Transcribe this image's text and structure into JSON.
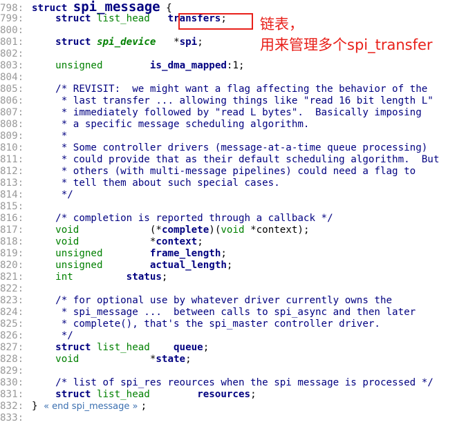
{
  "source": {
    "lines": [
      {
        "num": "798:",
        "segments": [
          {
            "c": "kw",
            "t": "struct "
          },
          {
            "c": "big",
            "t": "spi_message"
          },
          {
            "c": "br",
            "t": " {"
          }
        ]
      },
      {
        "num": "799:",
        "segments": [
          {
            "c": "nm",
            "t": "    "
          },
          {
            "c": "kw",
            "t": "struct "
          },
          {
            "c": "ty",
            "t": "list_head"
          },
          {
            "c": "nm",
            "t": "   "
          },
          {
            "c": "b",
            "t": "transfers"
          },
          {
            "c": "nm",
            "t": ";"
          }
        ]
      },
      {
        "num": "800:",
        "segments": []
      },
      {
        "num": "801:",
        "segments": [
          {
            "c": "nm",
            "t": "    "
          },
          {
            "c": "kw",
            "t": "struct "
          },
          {
            "c": "tyi",
            "t": "spi_device"
          },
          {
            "c": "nm",
            "t": "   *"
          },
          {
            "c": "b",
            "t": "spi"
          },
          {
            "c": "nm",
            "t": ";"
          }
        ]
      },
      {
        "num": "802:",
        "segments": []
      },
      {
        "num": "803:",
        "segments": [
          {
            "c": "nm",
            "t": "    "
          },
          {
            "c": "ty",
            "t": "unsigned"
          },
          {
            "c": "nm",
            "t": "        "
          },
          {
            "c": "b",
            "t": "is_dma_mapped"
          },
          {
            "c": "nm",
            "t": ":1;"
          }
        ]
      },
      {
        "num": "804:",
        "segments": []
      },
      {
        "num": "805:",
        "segments": [
          {
            "c": "cm",
            "t": "    /* REVISIT:  we might want a flag affecting the behavior of the"
          }
        ]
      },
      {
        "num": "806:",
        "segments": [
          {
            "c": "cm",
            "t": "     * last transfer ... allowing things like \"read 16 bit length L\""
          }
        ]
      },
      {
        "num": "807:",
        "segments": [
          {
            "c": "cm",
            "t": "     * immediately followed by \"read L bytes\".  Basically imposing"
          }
        ]
      },
      {
        "num": "808:",
        "segments": [
          {
            "c": "cm",
            "t": "     * a specific message scheduling algorithm."
          }
        ]
      },
      {
        "num": "809:",
        "segments": [
          {
            "c": "cm",
            "t": "     *"
          }
        ]
      },
      {
        "num": "810:",
        "segments": [
          {
            "c": "cm",
            "t": "     * Some controller drivers (message-at-a-time queue processing)"
          }
        ]
      },
      {
        "num": "811:",
        "segments": [
          {
            "c": "cm",
            "t": "     * could provide that as their default scheduling algorithm.  But"
          }
        ]
      },
      {
        "num": "812:",
        "segments": [
          {
            "c": "cm",
            "t": "     * others (with multi-message pipelines) could need a flag to"
          }
        ]
      },
      {
        "num": "813:",
        "segments": [
          {
            "c": "cm",
            "t": "     * tell them about such special cases."
          }
        ]
      },
      {
        "num": "814:",
        "segments": [
          {
            "c": "cm",
            "t": "     */"
          }
        ]
      },
      {
        "num": "815:",
        "segments": []
      },
      {
        "num": "816:",
        "segments": [
          {
            "c": "cm",
            "t": "    /* completion is reported through a callback */"
          }
        ]
      },
      {
        "num": "817:",
        "segments": [
          {
            "c": "nm",
            "t": "    "
          },
          {
            "c": "ty",
            "t": "void"
          },
          {
            "c": "nm",
            "t": "            (*"
          },
          {
            "c": "b",
            "t": "complete"
          },
          {
            "c": "nm",
            "t": ")("
          },
          {
            "c": "ty",
            "t": "void"
          },
          {
            "c": "nm",
            "t": " *context);"
          }
        ]
      },
      {
        "num": "818:",
        "segments": [
          {
            "c": "nm",
            "t": "    "
          },
          {
            "c": "ty",
            "t": "void"
          },
          {
            "c": "nm",
            "t": "            *"
          },
          {
            "c": "b",
            "t": "context"
          },
          {
            "c": "nm",
            "t": ";"
          }
        ]
      },
      {
        "num": "819:",
        "segments": [
          {
            "c": "nm",
            "t": "    "
          },
          {
            "c": "ty",
            "t": "unsigned"
          },
          {
            "c": "nm",
            "t": "        "
          },
          {
            "c": "b",
            "t": "frame_length"
          },
          {
            "c": "nm",
            "t": ";"
          }
        ]
      },
      {
        "num": "820:",
        "segments": [
          {
            "c": "nm",
            "t": "    "
          },
          {
            "c": "ty",
            "t": "unsigned"
          },
          {
            "c": "nm",
            "t": "        "
          },
          {
            "c": "b",
            "t": "actual_length"
          },
          {
            "c": "nm",
            "t": ";"
          }
        ]
      },
      {
        "num": "821:",
        "segments": [
          {
            "c": "nm",
            "t": "    "
          },
          {
            "c": "ty",
            "t": "int"
          },
          {
            "c": "nm",
            "t": "         "
          },
          {
            "c": "b",
            "t": "status"
          },
          {
            "c": "nm",
            "t": ";"
          }
        ]
      },
      {
        "num": "822:",
        "segments": []
      },
      {
        "num": "823:",
        "segments": [
          {
            "c": "cm",
            "t": "    /* for optional use by whatever driver currently owns the"
          }
        ]
      },
      {
        "num": "824:",
        "segments": [
          {
            "c": "cm",
            "t": "     * spi_message ...  between calls to spi_async and then later"
          }
        ]
      },
      {
        "num": "825:",
        "segments": [
          {
            "c": "cm",
            "t": "     * complete(), that's the spi_master controller driver."
          }
        ]
      },
      {
        "num": "826:",
        "segments": [
          {
            "c": "cm",
            "t": "     */"
          }
        ]
      },
      {
        "num": "827:",
        "segments": [
          {
            "c": "nm",
            "t": "    "
          },
          {
            "c": "kw",
            "t": "struct "
          },
          {
            "c": "ty",
            "t": "list_head"
          },
          {
            "c": "nm",
            "t": "    "
          },
          {
            "c": "b",
            "t": "queue"
          },
          {
            "c": "nm",
            "t": ";"
          }
        ]
      },
      {
        "num": "828:",
        "segments": [
          {
            "c": "nm",
            "t": "    "
          },
          {
            "c": "ty",
            "t": "void"
          },
          {
            "c": "nm",
            "t": "            *"
          },
          {
            "c": "b",
            "t": "state"
          },
          {
            "c": "nm",
            "t": ";"
          }
        ]
      },
      {
        "num": "829:",
        "segments": []
      },
      {
        "num": "830:",
        "segments": [
          {
            "c": "cm",
            "t": "    /* list of spi_res reources when the spi message is processed */"
          }
        ]
      },
      {
        "num": "831:",
        "segments": [
          {
            "c": "nm",
            "t": "    "
          },
          {
            "c": "kw",
            "t": "struct "
          },
          {
            "c": "ty",
            "t": "list_head"
          },
          {
            "c": "nm",
            "t": "        "
          },
          {
            "c": "b",
            "t": "resources"
          },
          {
            "c": "nm",
            "t": ";"
          }
        ]
      },
      {
        "num": "832:",
        "segments": [
          {
            "c": "br",
            "t": "} "
          },
          {
            "c": "endtag",
            "t": "« end spi_message » "
          },
          {
            "c": "nm",
            "t": ";"
          }
        ]
      },
      {
        "num": "833:",
        "segments": []
      }
    ]
  },
  "annotation": {
    "line1": "链表，",
    "line2": "用来管理多个spi_transfer",
    "color": "#e8201a"
  },
  "colors": {
    "keyword": "#000080",
    "type": "#008000",
    "line_number": "#999999",
    "background": "#ffffff"
  }
}
